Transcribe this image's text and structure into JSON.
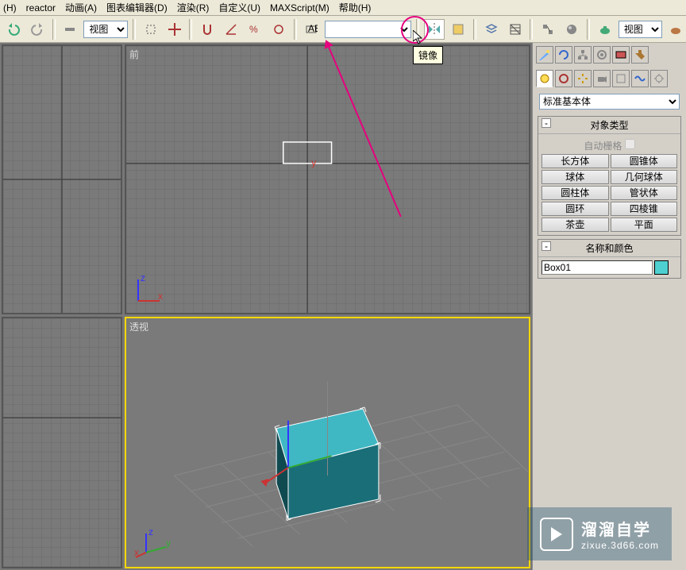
{
  "menu": {
    "items": [
      "(H)",
      "reactor",
      "动画(A)",
      "图表编辑器(D)",
      "渲染(R)",
      "自定义(U)",
      "MAXScript(M)",
      "帮助(H)"
    ]
  },
  "toolbar": {
    "view_select_1": "视图",
    "view_select_2": "视图",
    "selection_set": "",
    "tooltip_mirror": "镜像"
  },
  "viewports": {
    "front_label": "前",
    "persp_label": "透视"
  },
  "sidepanel": {
    "category": "标准基本体",
    "rollout_objtype": {
      "title": "对象类型",
      "autogrid": "自动栅格",
      "buttons": [
        [
          "长方体",
          "圆锥体"
        ],
        [
          "球体",
          "几何球体"
        ],
        [
          "圆柱体",
          "管状体"
        ],
        [
          "圆环",
          "四棱锥"
        ],
        [
          "茶壶",
          "平面"
        ]
      ]
    },
    "rollout_name": {
      "title": "名称和颜色",
      "name": "Box01",
      "color": "#4fd0d0"
    }
  },
  "watermark": {
    "title": "溜溜自学",
    "url": "zixue.3d66.com"
  }
}
